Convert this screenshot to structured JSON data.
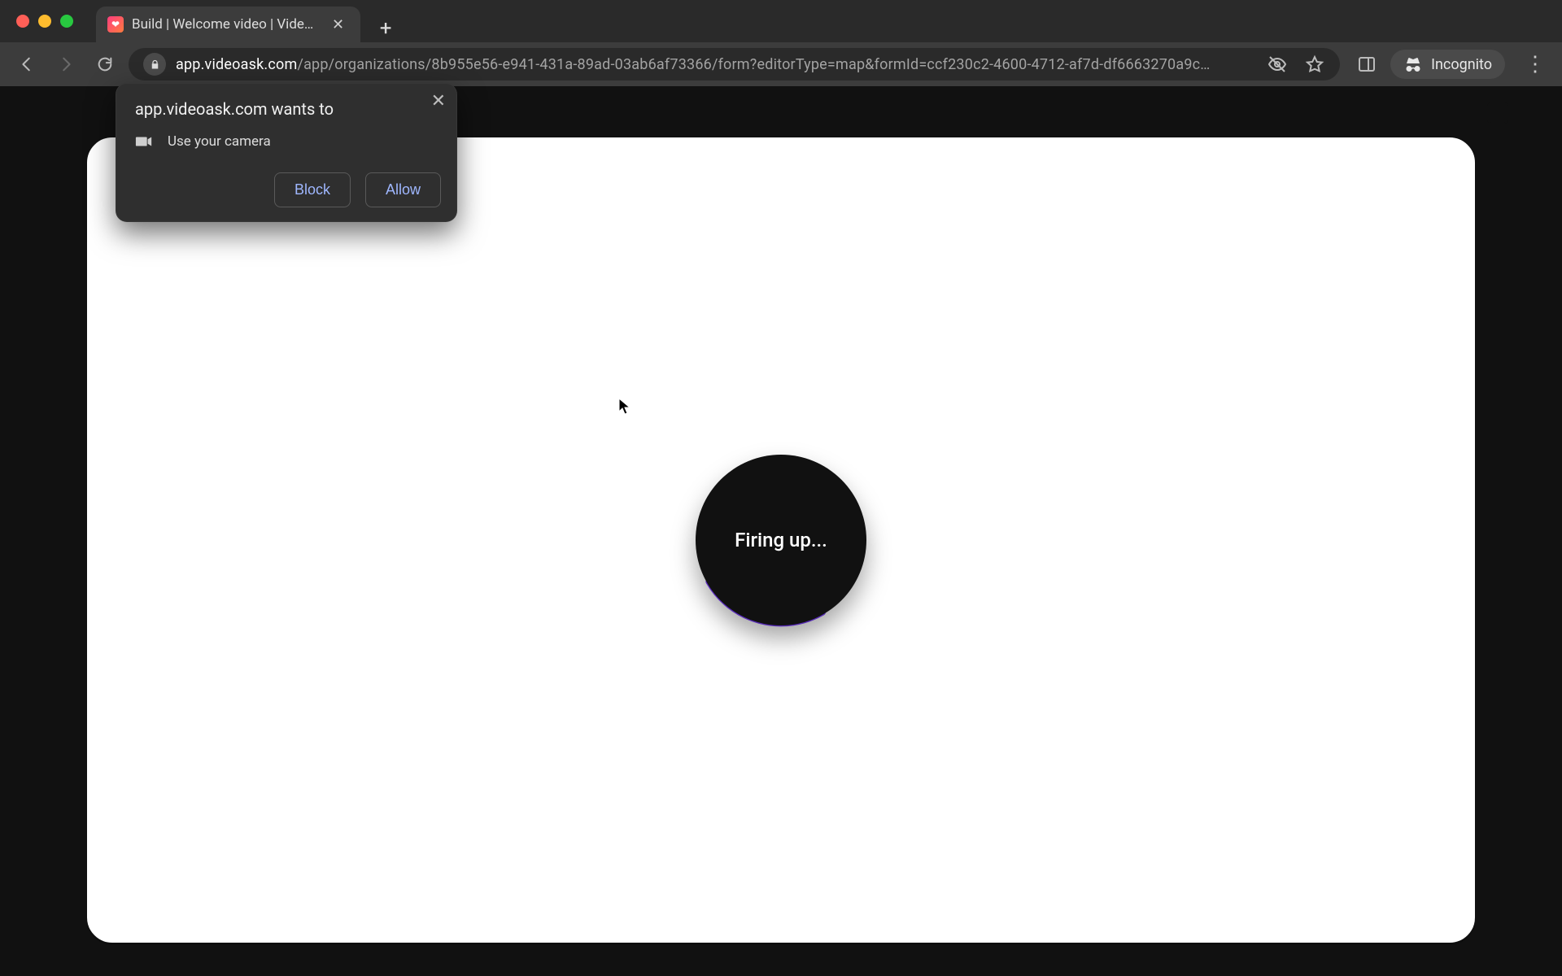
{
  "browser": {
    "tab_title": "Build | Welcome video | VideoA",
    "url_domain": "app.videoask.com",
    "url_path": "/app/organizations/8b955e56-e941-431a-89ad-03ab6af73366/form?editorType=map&formId=ccf230c2-4600-4712-af7d-df6663270a9c…",
    "incognito_label": "Incognito"
  },
  "permission": {
    "title": "app.videoask.com wants to",
    "request": "Use your camera",
    "block": "Block",
    "allow": "Allow"
  },
  "app": {
    "loading_text": "Firing up...",
    "close_sub": ""
  },
  "colors": {
    "accent": "#7a3cff"
  }
}
